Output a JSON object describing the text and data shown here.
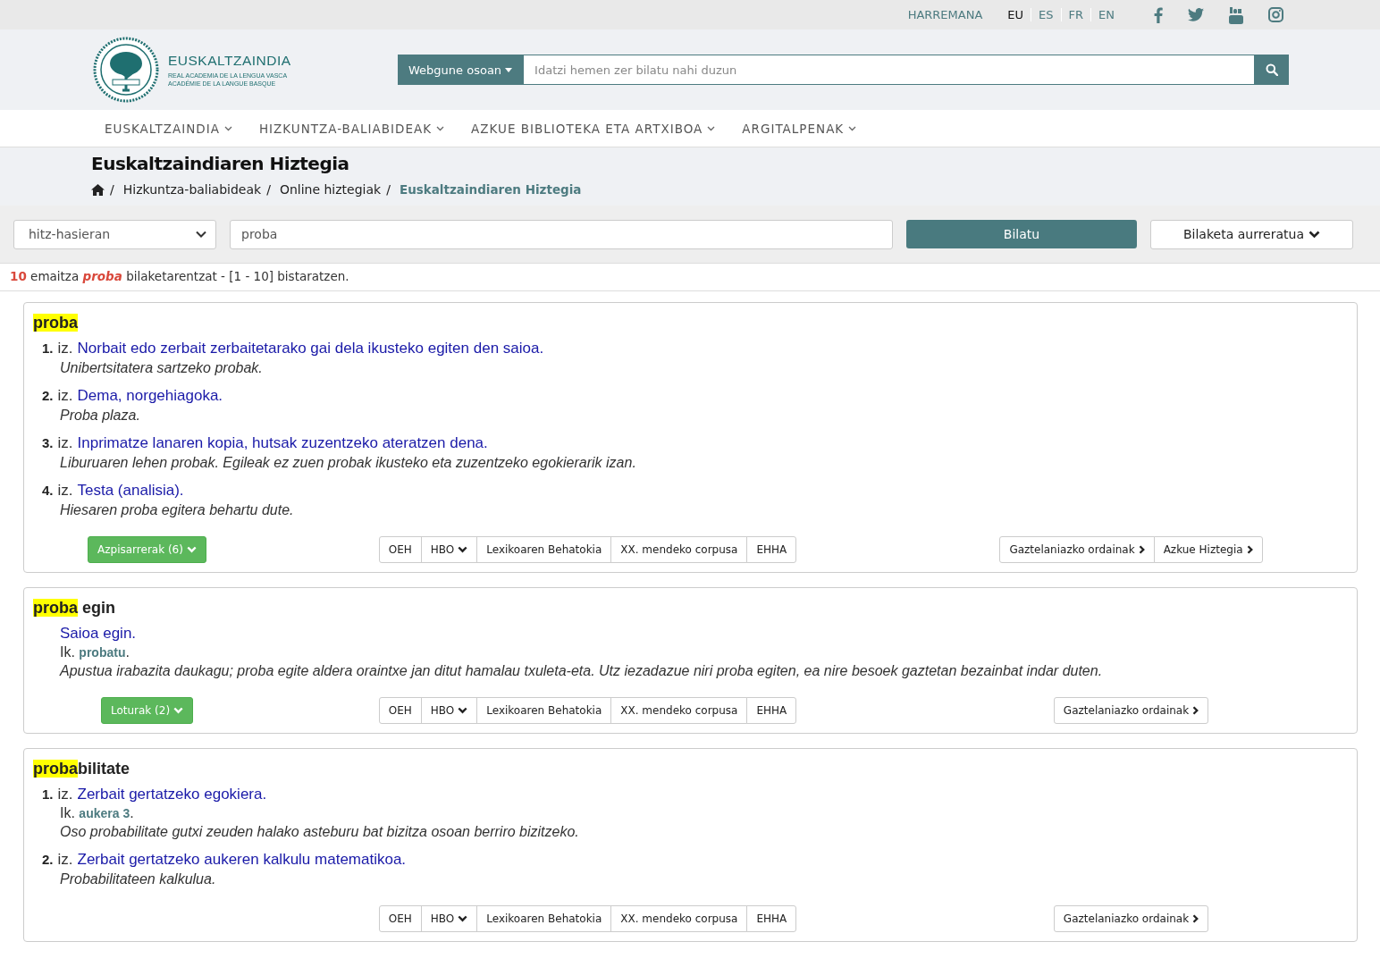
{
  "top_bar": {
    "contact": "HARREMANA",
    "languages": [
      {
        "label": "EU",
        "selected": true
      },
      {
        "label": "ES",
        "selected": false
      },
      {
        "label": "FR",
        "selected": false
      },
      {
        "label": "EN",
        "selected": false
      }
    ],
    "social": [
      {
        "kind": "facebook"
      },
      {
        "kind": "twitter"
      },
      {
        "kind": "youtube"
      },
      {
        "kind": "instagram"
      }
    ]
  },
  "header": {
    "logo": {
      "name": "EUSKALTZAINDIA",
      "line_1": "REAL ACADEMIA DE LA LENGUA VASCA",
      "line_2": "ACADÉMIE DE LA LANGUE BASQUE"
    },
    "search": {
      "scope": "Webgune osoan",
      "placeholder": "Idatzi hemen zer bilatu nahi duzun"
    }
  },
  "nav": [
    "EUSKALTZAINDIA",
    "HIZKUNTZA-BALIABIDEAK",
    "AZKUE BIBLIOTEKA ETA ARTXIBOA",
    "ARGITALPENAK"
  ],
  "page_title": "Euskaltzaindiaren Hiztegia",
  "breadcrumb": [
    {
      "kind": "home",
      "separator": "/"
    },
    {
      "kind": "link",
      "label": "Hizkuntza-baliabideak",
      "separator": "/"
    },
    {
      "kind": "link",
      "label": "Online hiztegiak",
      "separator": "/"
    },
    {
      "kind": "current",
      "label": "Euskaltzaindiaren Hiztegia"
    }
  ],
  "search_form": {
    "mode": "hitz-hasieran",
    "query": "proba",
    "submit": "Bilatu",
    "advanced": "Bilaketa aurreratua"
  },
  "summary": {
    "count": "10",
    "label": "emaitza",
    "term": "proba",
    "rest": "bilaketarentzat - [1 - 10] bistaratzen."
  },
  "entries": [
    {
      "head_match": "proba",
      "senses": [
        {
          "number": "1.",
          "pos": "iz.",
          "definition": "Norbait edo zerbait zerbaitetarako gai dela ikusteko egiten den saioa.",
          "example": "Unibertsitatera sartzeko probak."
        },
        {
          "number": "2.",
          "pos": "iz.",
          "definition": "Dema, norgehiagoka.",
          "example": "Proba plaza."
        },
        {
          "number": "3.",
          "pos": "iz.",
          "definition": "Inprimatze lanaren kopia, hutsak zuzentzeko ateratzen dena.",
          "example": "Liburuaren lehen probak. Egileak ez zuen probak ikusteko eta zuzentzeko egokierarik izan."
        },
        {
          "number": "4.",
          "pos": "iz.",
          "definition": "Testa (analisia).",
          "example": "Hiesaren proba egitera behartu dute."
        }
      ],
      "toggle": "Azpisarrerak (6)",
      "resources": [
        {
          "label": "OEH",
          "dropdown": false
        },
        {
          "label": "HBO",
          "dropdown": true
        },
        {
          "label": "Lexikoaren Behatokia",
          "dropdown": false
        },
        {
          "label": "XX. mendeko corpusa",
          "dropdown": false
        },
        {
          "label": "EHHA",
          "dropdown": false
        }
      ],
      "links": [
        "Gaztelaniazko ordainak",
        "Azkue Hiztegia"
      ]
    },
    {
      "head_match": "proba",
      "head_rest": " egin",
      "senses": [
        {
          "definition": "Saioa egin.",
          "see_also": {
            "label": "Ik.",
            "term": "probatu",
            "end": "."
          },
          "example": "Apustua irabazita daukagu; proba egite aldera oraintxe jan ditut hamalau txuleta-eta. Utz iezadazue niri proba egiten, ea nire besoek gaztetan bezainbat indar duten."
        }
      ],
      "toggle": "Loturak (2)",
      "resources": [
        {
          "label": "OEH",
          "dropdown": false
        },
        {
          "label": "HBO",
          "dropdown": true
        },
        {
          "label": "Lexikoaren Behatokia",
          "dropdown": false
        },
        {
          "label": "XX. mendeko corpusa",
          "dropdown": false
        },
        {
          "label": "EHHA",
          "dropdown": false
        }
      ],
      "links": [
        "Gaztelaniazko ordainak"
      ]
    },
    {
      "head_match": "proba",
      "head_rest": "bilitate",
      "senses": [
        {
          "number": "1.",
          "pos": "iz.",
          "definition": "Zerbait gertatzeko egokiera.",
          "see_also": {
            "label": "Ik.",
            "term": "aukera 3",
            "end": "."
          },
          "example": "Oso probabilitate gutxi zeuden halako asteburu bat bizitza osoan berriro bizitzeko."
        },
        {
          "number": "2.",
          "pos": "iz.",
          "definition": "Zerbait gertatzeko aukeren kalkulu matematikoa.",
          "example": "Probabilitateen kalkulua."
        }
      ],
      "resources": [
        {
          "label": "OEH",
          "dropdown": false
        },
        {
          "label": "HBO",
          "dropdown": true
        },
        {
          "label": "Lexikoaren Behatokia",
          "dropdown": false
        },
        {
          "label": "XX. mendeko corpusa",
          "dropdown": false
        },
        {
          "label": "EHHA",
          "dropdown": false
        }
      ],
      "links": [
        "Gaztelaniazko ordainak"
      ]
    }
  ]
}
